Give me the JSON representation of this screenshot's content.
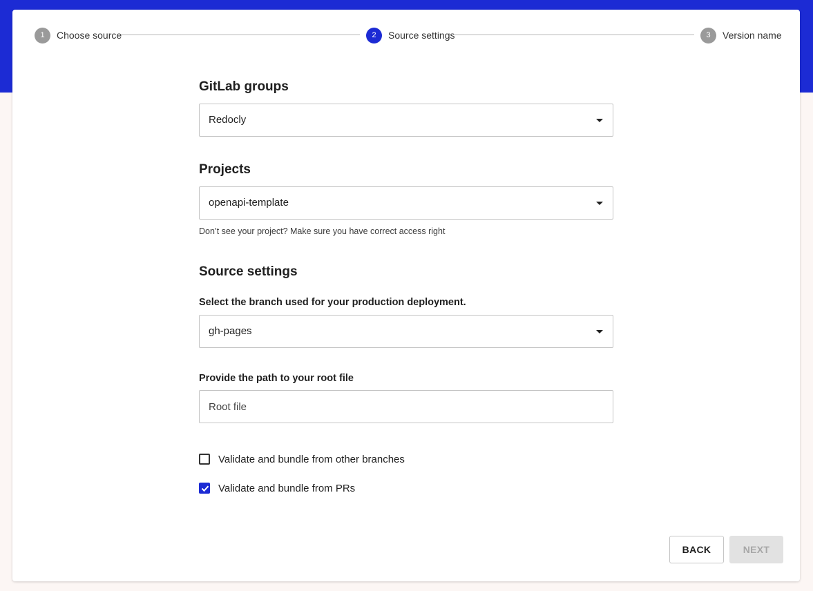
{
  "stepper": {
    "steps": [
      {
        "number": "1",
        "label": "Choose source",
        "state": "inactive"
      },
      {
        "number": "2",
        "label": "Source settings",
        "state": "active"
      },
      {
        "number": "3",
        "label": "Version name",
        "state": "inactive"
      }
    ]
  },
  "gitlab_groups": {
    "title": "GitLab groups",
    "selected": "Redocly"
  },
  "projects": {
    "title": "Projects",
    "selected": "openapi-template",
    "hint": "Don’t see your project? Make sure you have correct access right"
  },
  "source_settings": {
    "title": "Source settings",
    "branch_label": "Select the branch used for your production deployment.",
    "branch_selected": "gh-pages",
    "root_file_label": "Provide the path to your root file",
    "root_file_placeholder": "Root file",
    "root_file_value": ""
  },
  "options": [
    {
      "label": "Validate and bundle from other branches",
      "checked": false
    },
    {
      "label": "Validate and bundle from PRs",
      "checked": true
    }
  ],
  "buttons": {
    "back": "BACK",
    "next": "NEXT"
  },
  "colors": {
    "brand": "#1c2bd4",
    "annotation_arrow": "#e3191b",
    "disabled_button": "#e2e2e2"
  }
}
